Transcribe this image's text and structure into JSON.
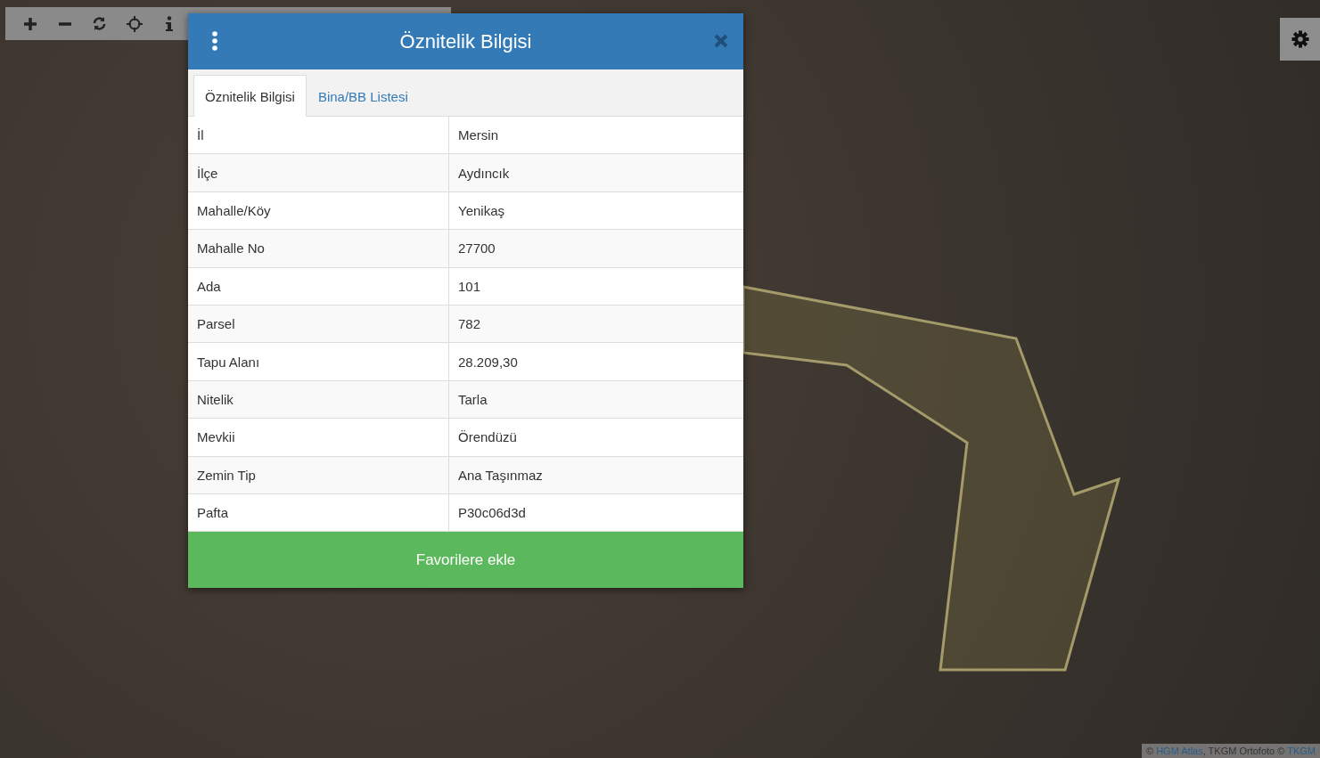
{
  "dialog": {
    "title": "Öznitelik Bilgisi",
    "tabs": [
      {
        "label": "Öznitelik Bilgisi",
        "selected": true
      },
      {
        "label": "Bina/BB Listesi",
        "selected": false
      }
    ],
    "rows": [
      {
        "label": "İl",
        "value": "Mersin"
      },
      {
        "label": "İlçe",
        "value": "Aydıncık"
      },
      {
        "label": "Mahalle/Köy",
        "value": "Yenikaş"
      },
      {
        "label": "Mahalle No",
        "value": "27700"
      },
      {
        "label": "Ada",
        "value": "101"
      },
      {
        "label": "Parsel",
        "value": "782"
      },
      {
        "label": "Tapu Alanı",
        "value": "28.209,30"
      },
      {
        "label": "Nitelik",
        "value": "Tarla"
      },
      {
        "label": "Mevkii",
        "value": "Örendüzü"
      },
      {
        "label": "Zemin Tip",
        "value": "Ana Taşınmaz"
      },
      {
        "label": "Pafta",
        "value": "P30c06d3d"
      }
    ],
    "button": "Favorilere ekle"
  },
  "attribution": [
    {
      "kind": "text",
      "text": "© "
    },
    {
      "kind": "link",
      "text": "HGM Atlas"
    },
    {
      "kind": "text",
      "text": ", TKGM Ortofoto © "
    },
    {
      "kind": "link",
      "text": "TKGM"
    }
  ]
}
